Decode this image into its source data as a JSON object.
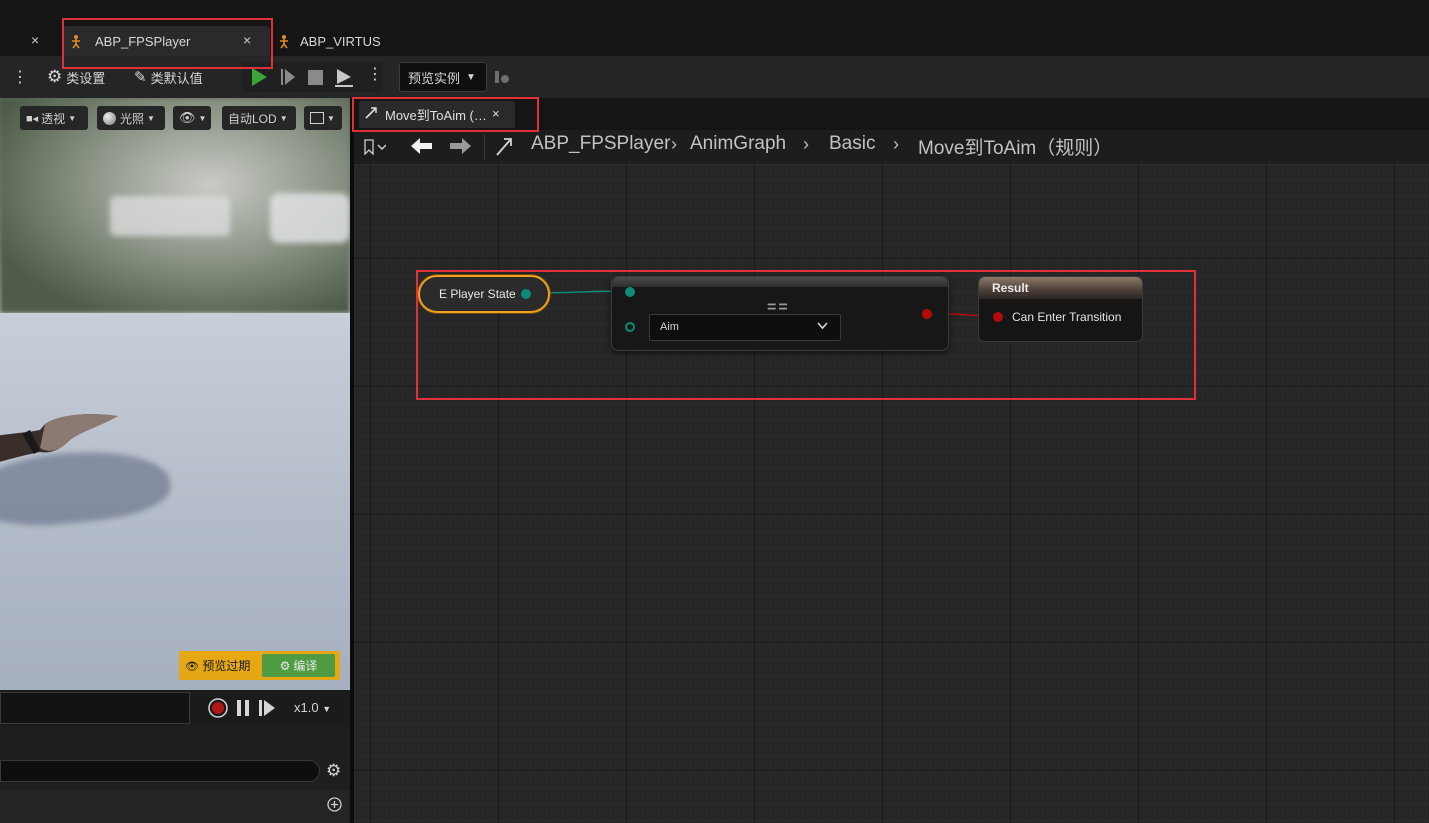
{
  "tabs": {
    "items": [
      {
        "label": "",
        "close": "×"
      },
      {
        "label": "ABP_FPSPlayer",
        "close": "×"
      },
      {
        "label": "ABP_VIRTUS",
        "close": ""
      }
    ]
  },
  "toolbar": {
    "class_settings": "类设置",
    "class_defaults": "类默认值",
    "preview_instance": "预览实例"
  },
  "viewport": {
    "perspective": "透视",
    "lighting": "光照",
    "lod": "自动LOD",
    "preview_expired": "预览过期",
    "compile": "编译",
    "playback_speed": "x1.0"
  },
  "graph": {
    "tab_label": "Move到ToAim (…",
    "tab_close": "×",
    "breadcrumb": [
      "ABP_FPSPlayer",
      "AnimGraph",
      "Basic",
      "Move到ToAim（规则）"
    ],
    "nodes": {
      "variable": {
        "label": "E Player State",
        "pin_color": "#0a8c78"
      },
      "equal": {
        "symbol": "==",
        "dropdown_value": "Aim",
        "pin_color": "#0a8c78",
        "out_pin_color": "#b50a0a"
      },
      "result": {
        "title": "Result",
        "pin_label": "Can Enter Transition",
        "pin_color": "#b50a0a"
      }
    }
  },
  "colors": {
    "highlight": "#e0303a",
    "selected_node": "#f0a020",
    "compile_green": "#4e9b41",
    "preview_yellow": "#e5a714",
    "play_green": "#3ea33a"
  }
}
